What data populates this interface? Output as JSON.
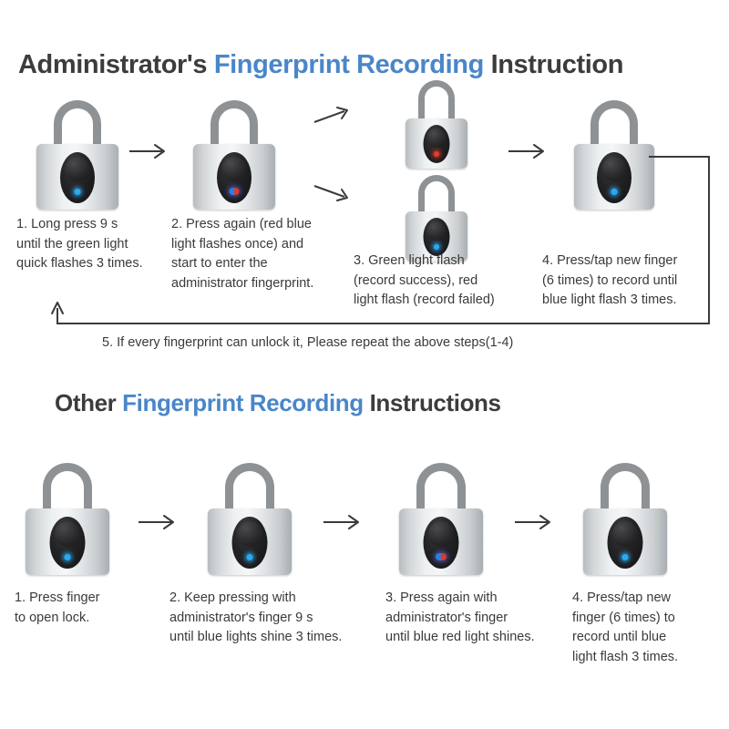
{
  "document": {
    "type": "fingerprint-padlock-instruction-sheet",
    "background_color": "#ffffff",
    "accent_color": "#4a86c8",
    "text_color": "#3a3a3a"
  },
  "sections": [
    {
      "id": "administrator",
      "heading": {
        "part1": "Administrator's ",
        "part2": "Fingerprint Recording",
        "part3": " Instruction"
      },
      "steps": [
        {
          "number": "1",
          "text": "1. Long press 9 s\nuntil the green light\nquick flashes 3 times.",
          "led": "blue"
        },
        {
          "number": "2",
          "text": "2. Press again (red blue\nlight flashes once) and\nstart to enter the\nadministrator fingerprint.",
          "led": "blue-red"
        },
        {
          "number": "3",
          "text": "3. Green light flash\n(record success), red\nlight flash (record failed)",
          "led": "red-and-blue-pair"
        },
        {
          "number": "4",
          "text": "4. Press/tap new finger\n(6 times) to record until\nblue light flash 3 times.",
          "led": "blue"
        }
      ],
      "loop_note": "5. If every fingerprint can unlock it, Please repeat the above steps(1-4)"
    },
    {
      "id": "other",
      "heading": {
        "part1": "Other ",
        "part2": "Fingerprint Recording",
        "part3": " Instructions"
      },
      "steps": [
        {
          "number": "1",
          "text": "1. Press finger\nto open lock.",
          "led": "blue"
        },
        {
          "number": "2",
          "text": "2. Keep pressing with\nadministrator's finger 9 s\nuntil blue lights shine 3 times.",
          "led": "blue"
        },
        {
          "number": "3",
          "text": "3. Press again with\nadministrator's finger\nuntil blue red light shines.",
          "led": "blue-red"
        },
        {
          "number": "4",
          "text": "4. Press/tap new\nfinger (6 times) to\nrecord until blue\nlight flash 3 times.",
          "led": "blue"
        }
      ]
    }
  ],
  "icons": {
    "padlock": "padlock-icon",
    "arrow_right": "arrow-right-icon",
    "arrow_up": "arrow-up-icon"
  }
}
